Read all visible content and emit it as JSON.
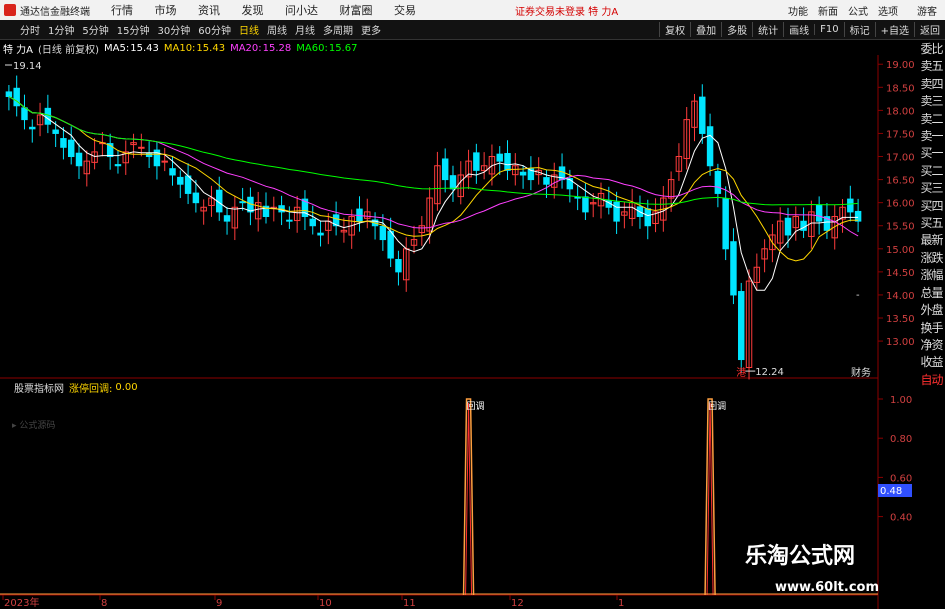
{
  "app": {
    "name": "通达信金融终端",
    "menu": [
      "行情",
      "市场",
      "资讯",
      "发现",
      "问小达",
      "财富圈",
      "交易"
    ],
    "alert": "证券交易未登录 特 力A",
    "right_menu": [
      "功能",
      "新面",
      "公式",
      "选项",
      "游客"
    ]
  },
  "toolbar": {
    "tabs": [
      "分时",
      "1分钟",
      "5分钟",
      "15分钟",
      "30分钟",
      "60分钟",
      "日线",
      "周线",
      "月线",
      "多周期",
      "更多"
    ],
    "active": "日线",
    "right": [
      "复权",
      "叠加",
      "多股",
      "统计",
      "画线",
      "F10",
      "标记",
      "+自选",
      "返回"
    ]
  },
  "stock": {
    "name": "特 力A",
    "adjust": "(日线 前复权)",
    "ma5_label": "MA5:",
    "ma5": "15.43",
    "ma10_label": "MA10:",
    "ma10": "15.43",
    "ma20_label": "MA20:",
    "ma20": "15.28",
    "ma60_label": "MA60:",
    "ma60": "15.67"
  },
  "price_axis": [
    "19.00",
    "18.50",
    "18.00",
    "17.50",
    "17.00",
    "16.50",
    "16.00",
    "15.50",
    "15.00",
    "14.50",
    "14.00",
    "13.50",
    "13.00"
  ],
  "annotations": {
    "high": "19.14",
    "low": "12.24",
    "cursor_price": "-",
    "low_mark": "港",
    "caiwu": "财务"
  },
  "sidepanel": [
    "委比",
    "卖五",
    "卖四",
    "卖三",
    "卖二",
    "卖一",
    "买一",
    "买二",
    "买三",
    "买四",
    "买五",
    "最新",
    "涨跌",
    "涨幅",
    "总量",
    "外盘",
    "换手",
    "净资",
    "收益",
    "自动"
  ],
  "indicator": {
    "name": "股票指标网",
    "label": "涨停回调:",
    "value": "0.00",
    "source": "公式源码",
    "axis": [
      "1.00",
      "0.80",
      "0.60",
      "0.40"
    ],
    "cursor": "0.48",
    "signal1": "回调",
    "signal2": "回调"
  },
  "time_axis": [
    "2023年",
    "8",
    "9",
    "10",
    "11",
    "12",
    "1"
  ],
  "watermark": {
    "title": "乐淘公式网",
    "url": "www.60lt.com"
  },
  "colors": {
    "up": "#ff3c3c",
    "down": "#00e5ff",
    "ma5": "#ffffff",
    "ma10": "#ffd700",
    "ma20": "#ff40ff",
    "ma60": "#00ff00"
  },
  "chart_data": {
    "type": "candlestick",
    "price_range": [
      12.2,
      19.2
    ],
    "closes": [
      18.3,
      18.1,
      17.8,
      17.6,
      17.9,
      17.7,
      17.5,
      17.2,
      17.0,
      16.8,
      16.9,
      17.1,
      17.3,
      17.0,
      16.8,
      17.1,
      17.3,
      17.2,
      17.0,
      16.8,
      16.9,
      16.6,
      16.4,
      16.2,
      16.0,
      15.9,
      16.1,
      15.8,
      15.6,
      15.9,
      16.0,
      15.8,
      16.0,
      15.7,
      15.9,
      15.8,
      15.6,
      15.9,
      15.7,
      15.5,
      15.3,
      15.6,
      15.5,
      15.4,
      15.7,
      15.6,
      15.8,
      15.5,
      15.2,
      14.8,
      14.5,
      15.0,
      15.2,
      15.5,
      16.1,
      16.8,
      16.5,
      16.3,
      16.6,
      16.9,
      16.7,
      16.8,
      17.0,
      16.9,
      16.7,
      16.8,
      16.6,
      16.5,
      16.7,
      16.4,
      16.6,
      16.5,
      16.3,
      16.1,
      15.8,
      16.0,
      16.2,
      15.9,
      15.6,
      15.8,
      16.0,
      15.7,
      15.5,
      15.8,
      16.1,
      16.5,
      17.0,
      17.8,
      18.2,
      17.5,
      16.8,
      16.2,
      15.0,
      14.0,
      12.6,
      14.3,
      14.6,
      15.0,
      15.3,
      15.6,
      15.3,
      15.7,
      15.4,
      15.8,
      15.6,
      15.4,
      15.7,
      15.9,
      15.8,
      15.6
    ]
  }
}
